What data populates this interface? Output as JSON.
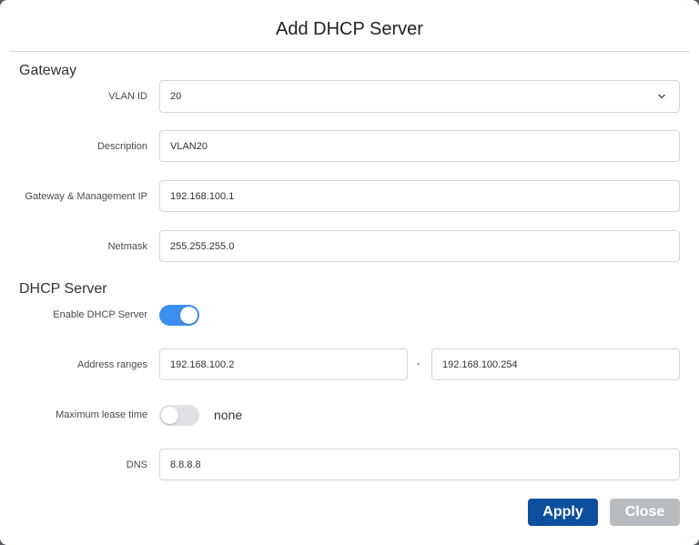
{
  "dialog": {
    "title": "Add DHCP Server"
  },
  "gateway": {
    "section_title": "Gateway",
    "vlan_id": {
      "label": "VLAN ID",
      "value": "20"
    },
    "description": {
      "label": "Description",
      "value": "VLAN20"
    },
    "gateway_ip": {
      "label": "Gateway & Management IP",
      "value": "192.168.100.1"
    },
    "netmask": {
      "label": "Netmask",
      "value": "255.255.255.0"
    }
  },
  "dhcp_server": {
    "section_title": "DHCP Server",
    "enable": {
      "label": "Enable DHCP Server",
      "state": "on"
    },
    "address_ranges": {
      "label": "Address ranges",
      "start": "192.168.100.2",
      "separator": "-",
      "end": "192.168.100.254"
    },
    "max_lease_time": {
      "label": "Maximum lease time",
      "state": "off",
      "value_text": "none"
    },
    "dns": {
      "label": "DNS",
      "value": "8.8.8.8"
    }
  },
  "buttons": {
    "apply": "Apply",
    "close": "Close"
  },
  "colors": {
    "accent_toggle": "#3d8fef",
    "apply_button": "#0d4f9e",
    "close_button": "#b9bcbf"
  },
  "icons": {
    "dropdown": "chevron-down-icon"
  }
}
